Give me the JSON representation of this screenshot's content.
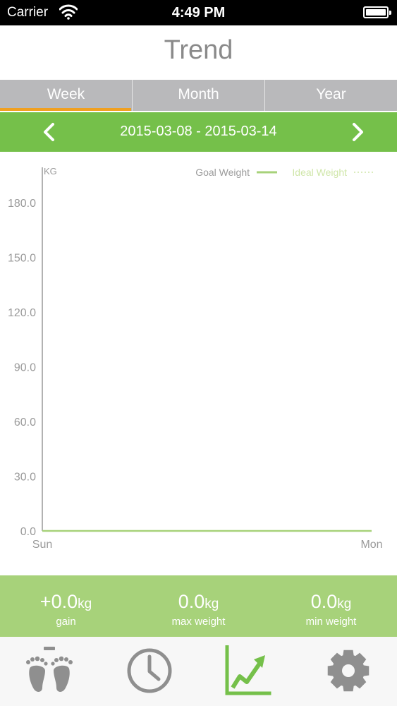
{
  "status_bar": {
    "carrier": "Carrier",
    "time": "4:49 PM"
  },
  "header": {
    "title": "Trend"
  },
  "tabs": [
    {
      "label": "Week",
      "selected": true
    },
    {
      "label": "Month",
      "selected": false
    },
    {
      "label": "Year",
      "selected": false
    }
  ],
  "date_range": {
    "label": "2015-03-08 - 2015-03-14"
  },
  "chart_data": {
    "type": "line",
    "ylabel": "KG",
    "ylim": [
      0,
      180
    ],
    "yticks": [
      0,
      30,
      60,
      90,
      120,
      150,
      180
    ],
    "ytick_labels": [
      "0.0",
      "30.0",
      "60.0",
      "90.0",
      "120.0",
      "150.0",
      "180.0"
    ],
    "x_start_label": "Sun",
    "x_end_label": "Mon",
    "legend": [
      {
        "name": "Goal Weight",
        "style": "solid"
      },
      {
        "name": "Ideal Weight",
        "style": "dotted"
      }
    ],
    "legend_position": "top-right",
    "series": [
      {
        "name": "Goal Weight",
        "values": [
          0,
          0
        ]
      }
    ],
    "colors": {
      "axis": "#999999",
      "line": "#a7d27a",
      "ideal": "#cfe6a8",
      "text": "#9a9a9a"
    }
  },
  "stats": [
    {
      "value": "+0.0",
      "unit": "kg",
      "label": "gain"
    },
    {
      "value": "0.0",
      "unit": "kg",
      "label": "max weight"
    },
    {
      "value": "0.0",
      "unit": "kg",
      "label": "min weight"
    }
  ],
  "tab_bar": [
    {
      "icon": "footprints-icon",
      "selected": false
    },
    {
      "icon": "clock-icon",
      "selected": false
    },
    {
      "icon": "trend-chart-icon",
      "selected": true
    },
    {
      "icon": "gear-icon",
      "selected": false
    }
  ],
  "colors": {
    "accent_green": "#75c04a",
    "light_green": "#a7d27a",
    "tab_gray": "#b9b9bb",
    "tab_indicator": "#f0a020",
    "icon_gray": "#8f8f8f"
  }
}
